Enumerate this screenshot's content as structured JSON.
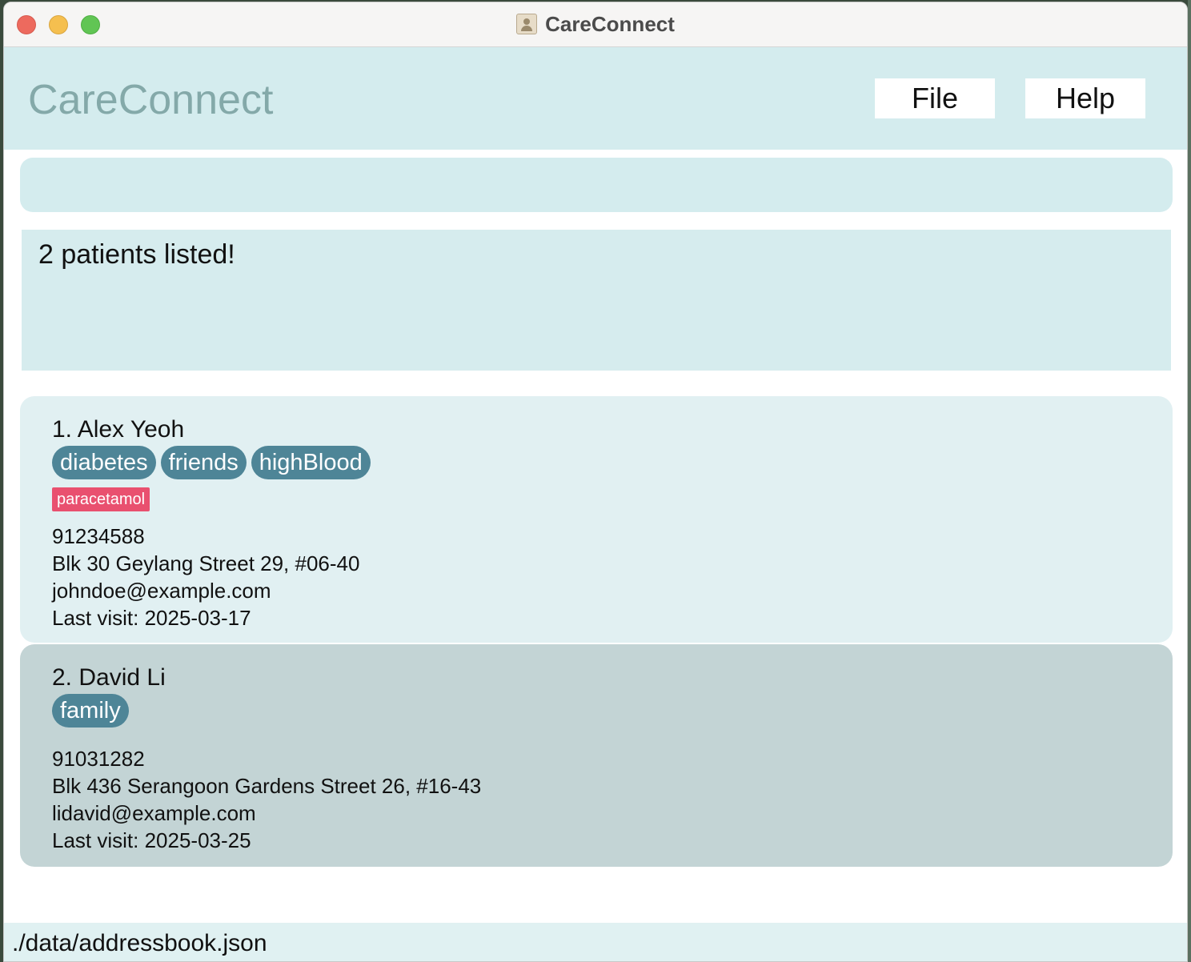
{
  "window": {
    "title": "CareConnect"
  },
  "header": {
    "brand": "CareConnect",
    "menu": {
      "file": "File",
      "help": "Help"
    }
  },
  "command": {
    "value": "",
    "placeholder": ""
  },
  "result": {
    "message": "2 patients listed!"
  },
  "patients": [
    {
      "name": "1. Alex Yeoh",
      "tags": [
        "diabetes",
        "friends",
        "highBlood"
      ],
      "medications": [
        "paracetamol"
      ],
      "phone": "91234588",
      "address": "Blk 30 Geylang Street 29, #06-40",
      "email": "johndoe@example.com",
      "last_visit": "Last visit: 2025-03-17"
    },
    {
      "name": "2. David Li",
      "tags": [
        "family"
      ],
      "medications": [],
      "phone": "91031282",
      "address": "Blk 436 Serangoon Gardens Street 26, #16-43",
      "email": "lidavid@example.com",
      "last_visit": "Last visit: 2025-03-25"
    }
  ],
  "status_bar": {
    "path": "./data/addressbook.json"
  },
  "colors": {
    "header_bg": "#d4ecee",
    "brand": "#84a9a9",
    "tag": "#4e8597",
    "medication": "#e9506f",
    "card_selected": "#c3d4d5"
  }
}
